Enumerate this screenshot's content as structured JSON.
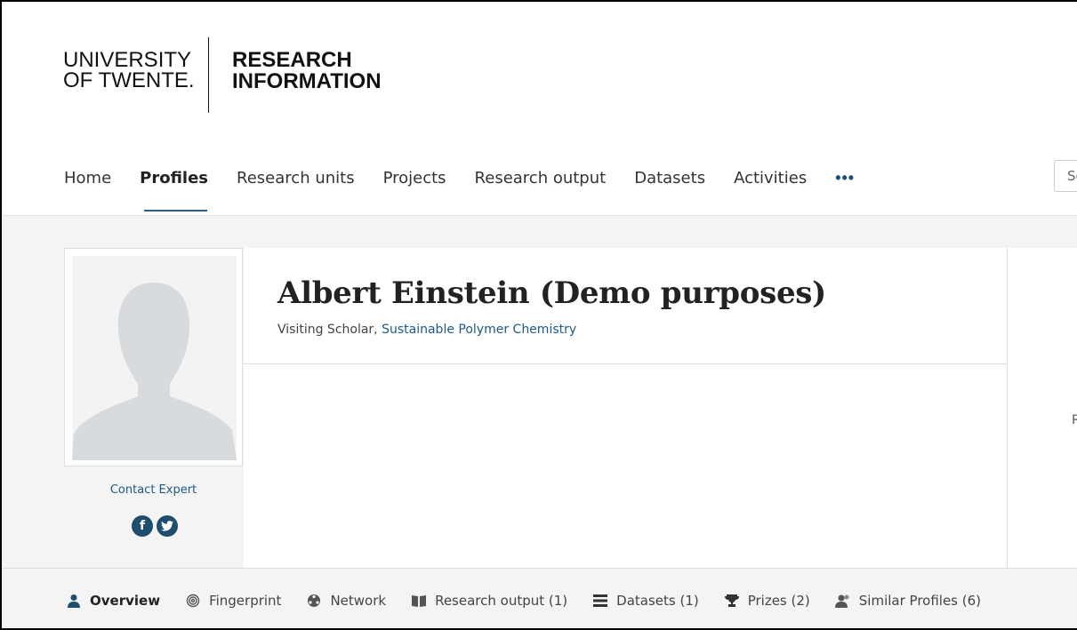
{
  "header": {
    "university_line1": "UNIVERSITY",
    "university_line2": "OF TWENTE.",
    "portal_line1": "RESEARCH",
    "portal_line2": "INFORMATION"
  },
  "nav": {
    "items": [
      "Home",
      "Profiles",
      "Research units",
      "Projects",
      "Research output",
      "Datasets",
      "Activities"
    ],
    "active": "Profiles",
    "more_label": "•••"
  },
  "search": {
    "placeholder": "Se"
  },
  "profile": {
    "name": "Albert Einstein (Demo purposes)",
    "position": "Visiting Scholar, ",
    "department": "Sustainable Polymer Chemistry",
    "contact_label": "Contact Expert",
    "right_panel_text": "R"
  },
  "social": {
    "facebook": "f",
    "twitter": "t"
  },
  "tabs": [
    {
      "label": "Overview",
      "icon": "person-icon"
    },
    {
      "label": "Fingerprint",
      "icon": "fingerprint-icon"
    },
    {
      "label": "Network",
      "icon": "network-icon"
    },
    {
      "label": "Research output (1)",
      "icon": "book-icon"
    },
    {
      "label": "Datasets (1)",
      "icon": "datasets-icon"
    },
    {
      "label": "Prizes (2)",
      "icon": "trophy-icon"
    },
    {
      "label": "Similar Profiles (6)",
      "icon": "similar-profiles-icon"
    }
  ],
  "colors": {
    "accent": "#2b5f8a",
    "link": "#1c5a87",
    "social_bg": "#1f4d6e",
    "panel_bg": "#f4f4f4"
  }
}
